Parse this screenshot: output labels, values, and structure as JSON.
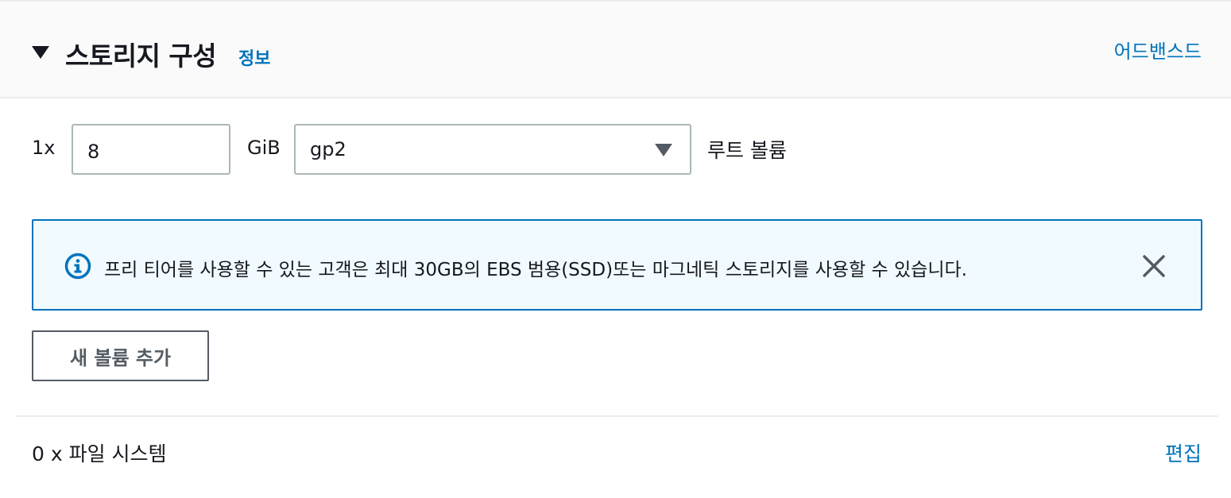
{
  "header": {
    "title": "스토리지 구성",
    "info_link": "정보",
    "advanced_link": "어드밴스드"
  },
  "volume": {
    "multiplier": "1x",
    "size_value": "8",
    "unit": "GiB",
    "type_selected": "gp2",
    "label": "루트 볼륨"
  },
  "alert": {
    "text": "프리 티어를 사용할 수 있는 고객은 최대 30GB의 EBS 범용(SSD)또는 마그네틱 스토리지를 사용할 수 있습니다.",
    "icon": "info-icon",
    "close_icon": "close-icon"
  },
  "actions": {
    "add_volume": "새 볼륨 추가"
  },
  "file_systems": {
    "label": "0 x 파일 시스템",
    "edit_link": "편집"
  },
  "colors": {
    "link": "#0073bb",
    "alert_border": "#0073bb",
    "alert_bg": "#f1faff",
    "header_bg": "#fafafa",
    "text": "#16191f",
    "button_text": "#545b64"
  }
}
